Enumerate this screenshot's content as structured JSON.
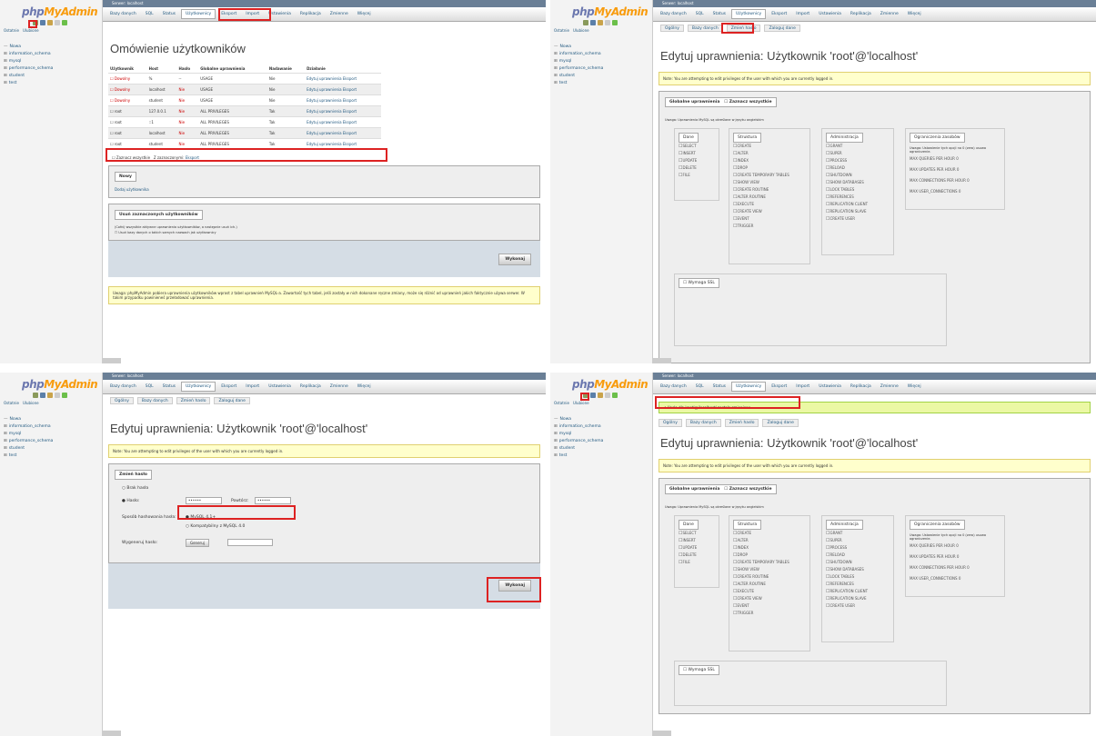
{
  "app": {
    "logo_a": "php",
    "logo_b": "MyAdmin",
    "side_tabs": [
      "Ostatnie",
      "Ulubione"
    ],
    "topbar": "Serwer: localhost"
  },
  "tree": [
    "Nowa",
    "information_schema",
    "mysql",
    "performance_schema",
    "student",
    "test"
  ],
  "menu": [
    "Bazy danych",
    "SQL",
    "Status",
    "Użytkownicy",
    "Eksport",
    "Import",
    "Ustawienia",
    "Replikacja",
    "Zmienne",
    "Więcej"
  ],
  "subtabs": [
    "Ogólny",
    "Bazy danych",
    "Zmień hasło",
    "Zaloguj dane"
  ],
  "panel1": {
    "title": "Omówienie użytkowników",
    "headers": [
      "Użytkownik",
      "Host",
      "Hasło",
      "Globalne uprawnienia",
      "Nadawanie",
      "Działanie"
    ],
    "rows": [
      [
        "Dowolny",
        "%",
        "--",
        "USAGE",
        "Nie",
        "Edytuj uprawnienia  Eksport"
      ],
      [
        "Dowolny",
        "localhost",
        "Nie",
        "USAGE",
        "Nie",
        "Edytuj uprawnienia  Eksport"
      ],
      [
        "Dowolny",
        "student",
        "Nie",
        "USAGE",
        "Nie",
        "Edytuj uprawnienia  Eksport"
      ],
      [
        "root",
        "127.0.0.1",
        "Nie",
        "ALL PRIVILEGES",
        "Tak",
        "Edytuj uprawnienia  Eksport"
      ],
      [
        "root",
        "::1",
        "Nie",
        "ALL PRIVILEGES",
        "Tak",
        "Edytuj uprawnienia  Eksport"
      ],
      [
        "root",
        "localhost",
        "Nie",
        "ALL PRIVILEGES",
        "Tak",
        "Edytuj uprawnienia  Eksport"
      ],
      [
        "root",
        "student",
        "Nie",
        "ALL PRIVILEGES",
        "Tak",
        "Edytuj uprawnienia  Eksport"
      ]
    ],
    "check_all": "Zaznacz wszystkie",
    "with_selected": "Z zaznaczonymi:",
    "export": "Eksport",
    "new_legend": "Nowy",
    "add_user": "Dodaj użytkownika",
    "remove_legend": "Usuń zaznaczonych użytkowników",
    "remove_desc": "(Cofnij wszystkie aktywne uprawnienia użytkowników, a następnie usuń ich.)",
    "remove_opt": "Usuń bazy danych o takich samych nazwach jak użytkownicy",
    "go": "Wykonaj",
    "note": "Uwaga: phpMyAdmin pobiera uprawnienia użytkowników wprost z tabel uprawnień MySQL-a. Zawartość tych tabel, jeśli zostały w nich dokonane ręczne zmiany, może się różnić od uprawnień jakich faktycznie używa serwer. W takim przypadku powinieneś przeładować uprawnienia."
  },
  "edit": {
    "title": "Edytuj uprawnienia: Użytkownik 'root'@'localhost'",
    "note": "Note: You are attempting to edit privileges of the user with which you are currently logged in.",
    "global": "Globalne uprawnienia",
    "check_all": "Zaznacz wszystkie",
    "hint": "Uwaga: Uprawnienia MySQL są określane w języku angielskim",
    "groups": {
      "data": {
        "label": "Dane",
        "items": [
          "SELECT",
          "INSERT",
          "UPDATE",
          "DELETE",
          "FILE"
        ]
      },
      "structure": {
        "label": "Struktura",
        "items": [
          "CREATE",
          "ALTER",
          "INDEX",
          "DROP",
          "CREATE TEMPORARY TABLES",
          "SHOW VIEW",
          "CREATE ROUTINE",
          "ALTER ROUTINE",
          "EXECUTE",
          "CREATE VIEW",
          "EVENT",
          "TRIGGER"
        ]
      },
      "admin": {
        "label": "Administracja",
        "items": [
          "GRANT",
          "SUPER",
          "PROCESS",
          "RELOAD",
          "SHUTDOWN",
          "SHOW DATABASES",
          "LOCK TABLES",
          "REFERENCES",
          "REPLICATION CLIENT",
          "REPLICATION SLAVE",
          "CREATE USER"
        ]
      },
      "limits": {
        "label": "Ograniczenia zasobów",
        "hint": "Uwaga: Ustawienie tych opcji na 0 (zero) usuwa ograniczenie.",
        "items": [
          "MAX QUERIES PER HOUR",
          "MAX UPDATES PER HOUR",
          "MAX CONNECTIONS PER HOUR",
          "MAX USER_CONNECTIONS"
        ],
        "value": "0"
      }
    },
    "ssl": "Wymaga SSL"
  },
  "panel3": {
    "legend": "Zmień hasło",
    "no_pw": "Brak hasła",
    "pw": "Hasło:",
    "retype": "Powtórz:",
    "pw_value": "••••••",
    "hash": "Sposób hashowania hasła:",
    "hash1": "MySQL 4.1+",
    "hash2": "Kompatybilny z MySQL 4.0",
    "gen": "Wygeneruj hasło:",
    "gen_btn": "Generuj",
    "go": "Wykonaj"
  },
  "panel4": {
    "success": "Hasło dla 'root'@'localhost' zostało zmienione."
  }
}
